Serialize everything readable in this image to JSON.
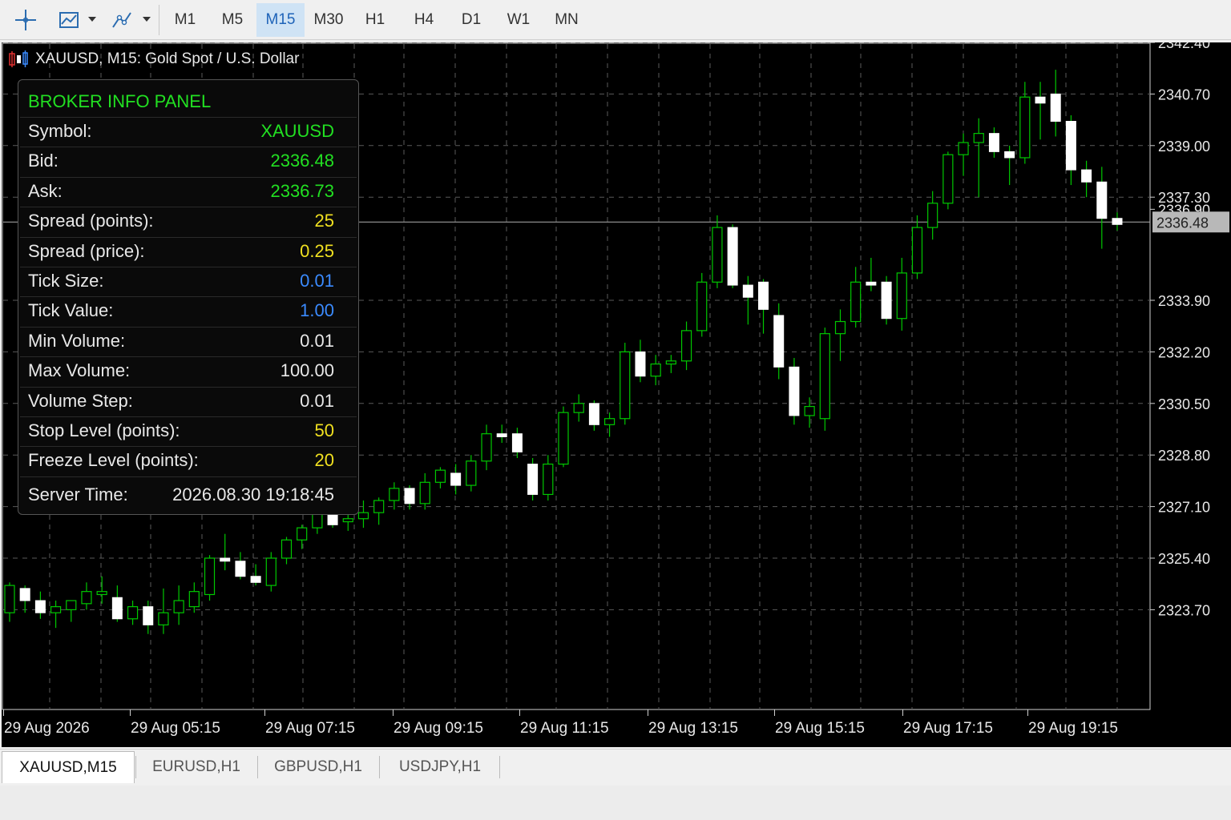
{
  "toolbar": {
    "tools": [
      {
        "name": "crosshair-icon"
      },
      {
        "name": "line-chart-tool-icon"
      },
      {
        "name": "draw-objects-icon"
      }
    ],
    "timeframes": [
      "M1",
      "M5",
      "M15",
      "M30",
      "H1",
      "H4",
      "D1",
      "W1",
      "MN"
    ],
    "active_timeframe": "M15"
  },
  "chart": {
    "title": "XAUUSD, M15:  Gold Spot / U.S. Dollar",
    "background": "#000000",
    "bull_color": "#00c800",
    "bear_color": "#ffffff",
    "current_price_label": "2336.48"
  },
  "panel": {
    "title": "BROKER INFO PANEL",
    "rows": [
      {
        "label": "Symbol:",
        "value": "XAUUSD",
        "color": "#22e022"
      },
      {
        "label": "Bid:",
        "value": "2336.48",
        "color": "#22e022"
      },
      {
        "label": "Ask:",
        "value": "2336.73",
        "color": "#22e022"
      },
      {
        "label": "Spread (points):",
        "value": "25",
        "color": "#f0e020"
      },
      {
        "label": "Spread (price):",
        "value": "0.25",
        "color": "#f0e020"
      },
      {
        "label": "Tick Size:",
        "value": "0.01",
        "color": "#3b8bff"
      },
      {
        "label": "Tick Value:",
        "value": "1.00",
        "color": "#3b8bff"
      },
      {
        "label": "Min Volume:",
        "value": "0.01",
        "color": "#e8e8e8"
      },
      {
        "label": "Max Volume:",
        "value": "100.00",
        "color": "#e8e8e8"
      },
      {
        "label": "Volume Step:",
        "value": "0.01",
        "color": "#e8e8e8"
      },
      {
        "label": "Stop Level (points):",
        "value": "50",
        "color": "#f0e020"
      },
      {
        "label": "Freeze Level (points):",
        "value": "20",
        "color": "#f0e020"
      },
      {
        "label": "Server Time:",
        "value": "2026.08.30 19:18:45",
        "color": "#e8e8e8"
      }
    ]
  },
  "tabs": [
    "XAUUSD,M15",
    "EURUSD,H1",
    "GBPUSD,H1",
    "USDJPY,H1"
  ],
  "active_tab": "XAUUSD,M15",
  "chart_data": {
    "type": "candlestick",
    "ylim": [
      2322.2,
      2343.5
    ],
    "y_ticks": [
      2342.4,
      2340.7,
      2339.0,
      2337.3,
      2336.9,
      2333.9,
      2332.2,
      2330.5,
      2328.8,
      2327.1,
      2325.4,
      2323.7
    ],
    "x_labels": [
      "29 Aug 2026",
      "29 Aug 05:15",
      "29 Aug 07:15",
      "29 Aug 09:15",
      "29 Aug 11:15",
      "29 Aug 13:15",
      "29 Aug 15:15",
      "29 Aug 17:15",
      "29 Aug 19:15"
    ],
    "current_price": 2336.48,
    "candles": [
      [
        2323.6,
        2324.6,
        2323.3,
        2324.5
      ],
      [
        2324.4,
        2324.5,
        2323.6,
        2324.0
      ],
      [
        2324.0,
        2324.3,
        2323.4,
        2323.6
      ],
      [
        2323.6,
        2324.0,
        2323.1,
        2323.8
      ],
      [
        2323.7,
        2324.0,
        2323.3,
        2324.0
      ],
      [
        2323.9,
        2324.6,
        2323.7,
        2324.3
      ],
      [
        2324.2,
        2324.8,
        2323.9,
        2324.3
      ],
      [
        2324.1,
        2324.5,
        2323.3,
        2323.4
      ],
      [
        2323.4,
        2324.0,
        2323.2,
        2323.8
      ],
      [
        2323.8,
        2324.0,
        2322.9,
        2323.2
      ],
      [
        2323.2,
        2324.4,
        2322.9,
        2323.6
      ],
      [
        2323.6,
        2324.5,
        2323.2,
        2324.0
      ],
      [
        2323.8,
        2324.6,
        2323.6,
        2324.3
      ],
      [
        2324.2,
        2325.5,
        2324.0,
        2325.4
      ],
      [
        2325.4,
        2326.2,
        2325.0,
        2325.3
      ],
      [
        2325.3,
        2325.6,
        2324.7,
        2324.8
      ],
      [
        2324.8,
        2325.2,
        2324.5,
        2324.6
      ],
      [
        2324.5,
        2325.6,
        2324.3,
        2325.4
      ],
      [
        2325.4,
        2326.1,
        2325.2,
        2326.0
      ],
      [
        2326.0,
        2326.5,
        2325.7,
        2326.4
      ],
      [
        2326.4,
        2327.6,
        2326.2,
        2327.3
      ],
      [
        2327.3,
        2327.6,
        2326.4,
        2326.5
      ],
      [
        2326.6,
        2326.9,
        2326.3,
        2326.7
      ],
      [
        2326.7,
        2327.3,
        2326.4,
        2326.9
      ],
      [
        2326.9,
        2327.4,
        2326.5,
        2327.3
      ],
      [
        2327.3,
        2327.9,
        2327.0,
        2327.7
      ],
      [
        2327.7,
        2327.8,
        2327.0,
        2327.2
      ],
      [
        2327.2,
        2328.2,
        2327.0,
        2327.9
      ],
      [
        2327.9,
        2328.4,
        2327.7,
        2328.3
      ],
      [
        2328.2,
        2328.5,
        2327.5,
        2327.8
      ],
      [
        2327.8,
        2328.8,
        2327.6,
        2328.6
      ],
      [
        2328.6,
        2329.8,
        2328.3,
        2329.5
      ],
      [
        2329.5,
        2329.8,
        2329.2,
        2329.4
      ],
      [
        2329.5,
        2329.7,
        2328.7,
        2328.9
      ],
      [
        2328.5,
        2328.7,
        2327.3,
        2327.5
      ],
      [
        2327.5,
        2328.8,
        2327.3,
        2328.5
      ],
      [
        2328.5,
        2330.4,
        2328.4,
        2330.2
      ],
      [
        2330.2,
        2330.8,
        2329.9,
        2330.5
      ],
      [
        2330.5,
        2330.6,
        2329.6,
        2329.8
      ],
      [
        2329.8,
        2330.2,
        2329.4,
        2330.0
      ],
      [
        2330.0,
        2332.5,
        2329.8,
        2332.2
      ],
      [
        2332.2,
        2332.6,
        2331.2,
        2331.4
      ],
      [
        2331.4,
        2332.1,
        2331.1,
        2331.8
      ],
      [
        2331.8,
        2332.1,
        2331.5,
        2331.9
      ],
      [
        2331.9,
        2333.2,
        2331.6,
        2332.9
      ],
      [
        2332.9,
        2334.8,
        2332.7,
        2334.5
      ],
      [
        2334.5,
        2336.7,
        2334.3,
        2336.3
      ],
      [
        2336.3,
        2336.4,
        2334.3,
        2334.4
      ],
      [
        2334.4,
        2334.7,
        2333.1,
        2334.0
      ],
      [
        2334.5,
        2334.6,
        2332.8,
        2333.6
      ],
      [
        2333.4,
        2333.8,
        2331.3,
        2331.7
      ],
      [
        2331.7,
        2332.0,
        2329.8,
        2330.1
      ],
      [
        2330.1,
        2330.7,
        2329.7,
        2330.4
      ],
      [
        2330.0,
        2333.0,
        2329.6,
        2332.8
      ],
      [
        2332.8,
        2333.6,
        2331.9,
        2333.2
      ],
      [
        2333.2,
        2335.0,
        2333.0,
        2334.5
      ],
      [
        2334.5,
        2335.3,
        2334.2,
        2334.4
      ],
      [
        2334.5,
        2334.7,
        2333.1,
        2333.3
      ],
      [
        2333.3,
        2335.3,
        2332.9,
        2334.8
      ],
      [
        2334.8,
        2336.7,
        2334.6,
        2336.3
      ],
      [
        2336.3,
        2337.5,
        2335.9,
        2337.1
      ],
      [
        2337.1,
        2338.8,
        2336.9,
        2338.7
      ],
      [
        2338.7,
        2339.4,
        2338.0,
        2339.1
      ],
      [
        2339.1,
        2339.9,
        2337.3,
        2339.4
      ],
      [
        2339.4,
        2339.6,
        2338.6,
        2338.8
      ],
      [
        2338.8,
        2339.0,
        2337.7,
        2338.6
      ],
      [
        2338.6,
        2341.1,
        2338.4,
        2340.6
      ],
      [
        2340.6,
        2341.1,
        2339.2,
        2340.4
      ],
      [
        2340.7,
        2341.5,
        2339.3,
        2339.8
      ],
      [
        2339.8,
        2340.0,
        2337.7,
        2338.2
      ],
      [
        2338.2,
        2338.5,
        2337.3,
        2337.8
      ],
      [
        2337.8,
        2338.3,
        2335.6,
        2336.6
      ],
      [
        2336.6,
        2336.8,
        2336.2,
        2336.4
      ]
    ]
  }
}
